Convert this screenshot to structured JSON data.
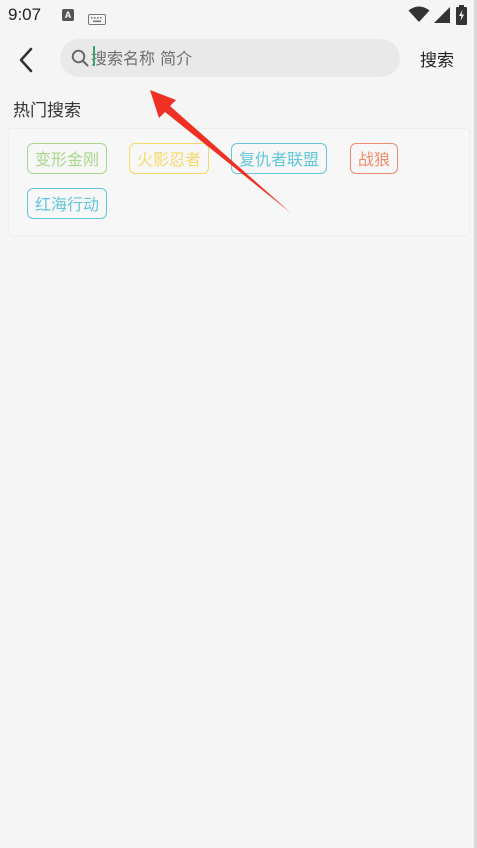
{
  "status_bar": {
    "time": "9:07",
    "a_icon_letter": "A",
    "icons": [
      "a-notification-icon",
      "keyboard-icon",
      "wifi-icon",
      "signal-icon",
      "battery-icon"
    ]
  },
  "top_bar": {
    "back_icon": "chevron-left-icon",
    "search_placeholder": "搜索名称 简介",
    "search_value": "",
    "search_button_label": "搜索"
  },
  "hot_search": {
    "title": "热门搜索",
    "tags": [
      {
        "label": "变形金刚",
        "color": "#a8d68a"
      },
      {
        "label": "火影忍者",
        "color": "#f3d96a"
      },
      {
        "label": "复仇者联盟",
        "color": "#63c6da"
      },
      {
        "label": "战狼",
        "color": "#f08c6e"
      },
      {
        "label": "红海行动",
        "color": "#63c6da"
      }
    ]
  },
  "annotation": {
    "color": "#ee3124"
  }
}
